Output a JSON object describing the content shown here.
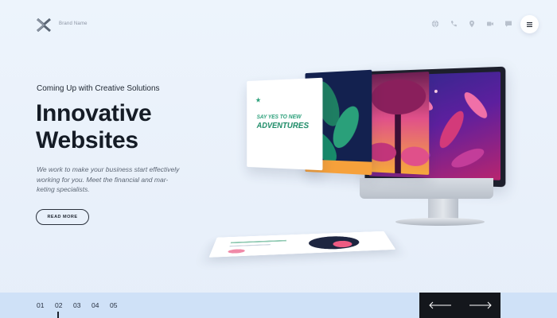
{
  "header": {
    "brand_name": "Brand Name",
    "icons": [
      "globe-icon",
      "phone-icon",
      "location-pin-icon",
      "video-icon",
      "chat-icon"
    ],
    "menu_icon": "hamburger-menu-icon"
  },
  "hero": {
    "eyebrow": "Coming Up with Creative Solutions",
    "title_line1": "Innovative",
    "title_line2": "Websites",
    "description": "We work to make your business start effectively working for you. Meet the financial and mar-keting specialists.",
    "read_more": "READ MORE"
  },
  "illustration": {
    "card_heading_small": "SAY YES TO NEW",
    "card_heading_big": "ADVENTURES"
  },
  "footer": {
    "slides": [
      "01",
      "02",
      "03",
      "04",
      "05"
    ],
    "active_slide": "02",
    "prev_icon": "arrow-left-icon",
    "next_icon": "arrow-right-icon"
  },
  "colors": {
    "background": "#e9f1fb",
    "bottom_bar": "#cfe1f7",
    "nav_box": "#14171c",
    "text_dark": "#151c26"
  }
}
